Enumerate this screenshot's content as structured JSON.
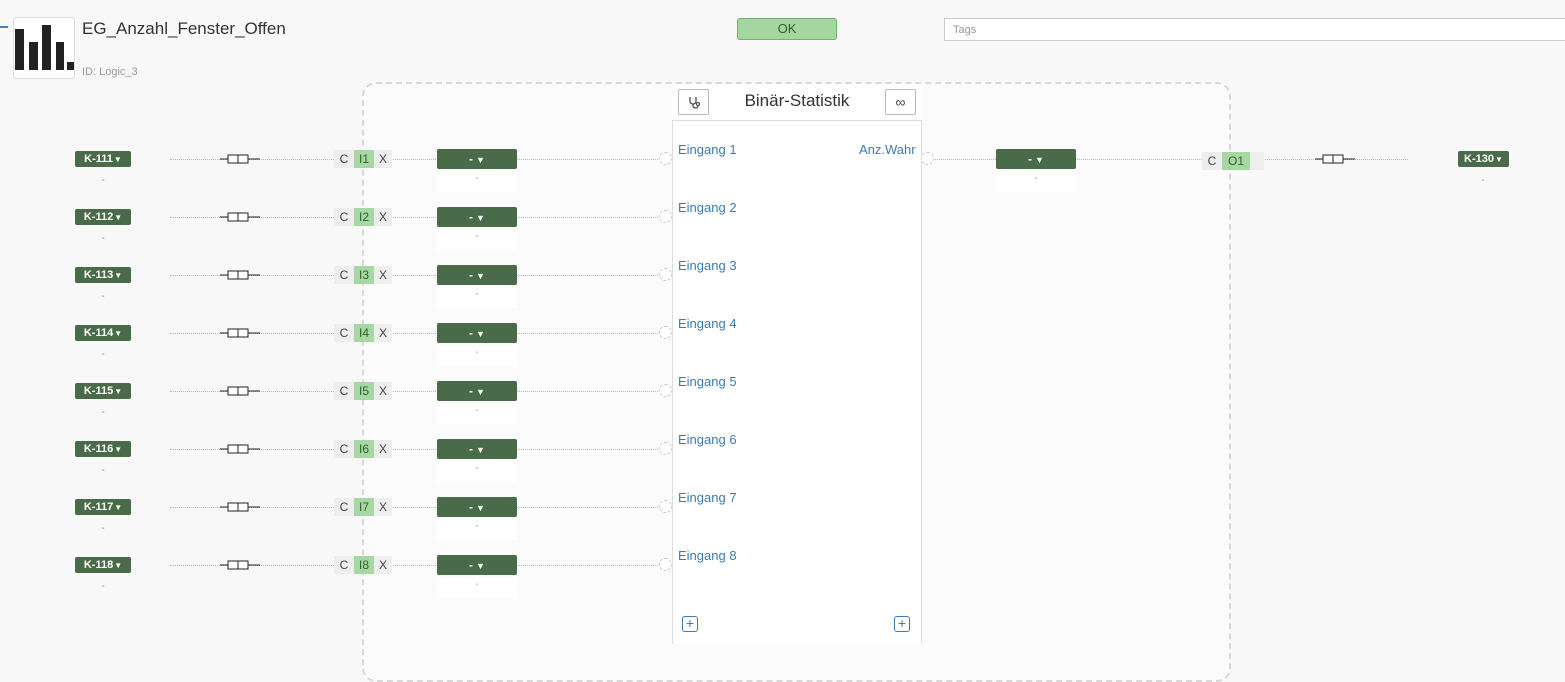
{
  "header": {
    "title": "EG_Anzahl_Fenster_Offen",
    "id_label": "ID: Logic_3",
    "status_button": "OK",
    "tags_placeholder": "Tags"
  },
  "node": {
    "title": "Binär-Statistik",
    "output_label": "Anz.Wahr",
    "left_button_icon": "stethoscope-icon",
    "right_button_icon": "infinity-icon",
    "inputs": [
      "Eingang 1",
      "Eingang 2",
      "Eingang 3",
      "Eingang 4",
      "Eingang 5",
      "Eingang 6",
      "Eingang 7",
      "Eingang 8"
    ]
  },
  "rows": [
    {
      "ko": "K-111",
      "ko_sub": "-",
      "c": "C",
      "port": "I1",
      "x": "X",
      "value": "-",
      "value_sub": "-"
    },
    {
      "ko": "K-112",
      "ko_sub": "-",
      "c": "C",
      "port": "I2",
      "x": "X",
      "value": "-",
      "value_sub": "-"
    },
    {
      "ko": "K-113",
      "ko_sub": "-",
      "c": "C",
      "port": "I3",
      "x": "X",
      "value": "-",
      "value_sub": "-"
    },
    {
      "ko": "K-114",
      "ko_sub": "-",
      "c": "C",
      "port": "I4",
      "x": "X",
      "value": "-",
      "value_sub": "-"
    },
    {
      "ko": "K-115",
      "ko_sub": "-",
      "c": "C",
      "port": "I5",
      "x": "X",
      "value": "-",
      "value_sub": "-"
    },
    {
      "ko": "K-116",
      "ko_sub": "-",
      "c": "C",
      "port": "I6",
      "x": "X",
      "value": "-",
      "value_sub": "-"
    },
    {
      "ko": "K-117",
      "ko_sub": "-",
      "c": "C",
      "port": "I7",
      "x": "X",
      "value": "-",
      "value_sub": "-"
    },
    {
      "ko": "K-118",
      "ko_sub": "-",
      "c": "C",
      "port": "I8",
      "x": "X",
      "value": "-",
      "value_sub": "-"
    }
  ],
  "output": {
    "ko": "K-130",
    "ko_sub": "-",
    "c": "C",
    "port": "O1",
    "value": "-",
    "value_sub": "-"
  },
  "colors": {
    "ko_badge": "#4a6b4a",
    "port_green": "#a7d8a4",
    "ok_green": "#a5d6a0",
    "link_blue": "#3d7ab5"
  },
  "icons": {
    "logic": "bar-chart-icon",
    "connector": "plug-icon",
    "add": "plus-square-icon"
  }
}
